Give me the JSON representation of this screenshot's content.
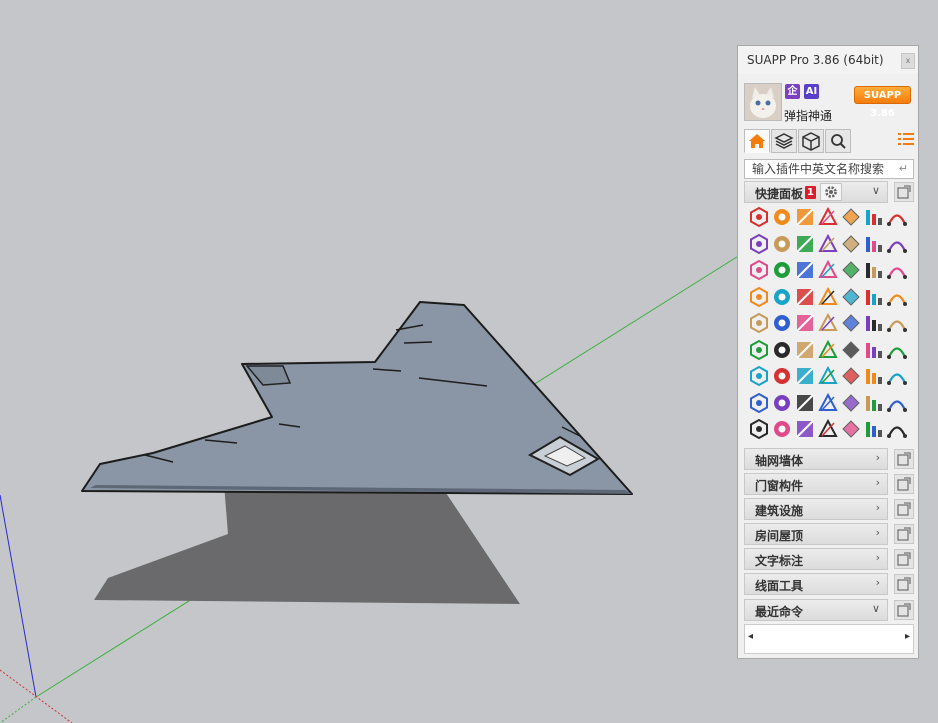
{
  "panel": {
    "title": "SUAPP Pro 3.86 (64bit)",
    "close_label": "x",
    "username": "弹指神通",
    "badge_enterprise": "企",
    "badge_ai": "AI",
    "version_button": "SUAPP 3.86",
    "search_placeholder": "输入插件中英文名称搜索",
    "enter_glyph": "↵",
    "quick_panel": {
      "label": "快捷面板",
      "badge": "1",
      "chevron": "∨"
    },
    "sections": [
      {
        "label": "轴网墙体",
        "chevron": "›"
      },
      {
        "label": "门窗构件",
        "chevron": "›"
      },
      {
        "label": "建筑设施",
        "chevron": "›"
      },
      {
        "label": "房间屋顶",
        "chevron": "›"
      },
      {
        "label": "文字标注",
        "chevron": "›"
      },
      {
        "label": "线面工具",
        "chevron": "›"
      },
      {
        "label": "最近命令",
        "chevron": "∨"
      }
    ],
    "recent_left": "◂",
    "recent_right": "▸",
    "tabs": [
      "home-icon",
      "layers-icon",
      "components-icon",
      "search-icon"
    ]
  },
  "colors": {
    "accent": "#f47c0c",
    "badge_red": "#d9202a",
    "enterprise": "#7b3fbf",
    "ai": "#5b3fc8",
    "model_body": "#8a96a6",
    "shadow": "#6a6a6c"
  }
}
